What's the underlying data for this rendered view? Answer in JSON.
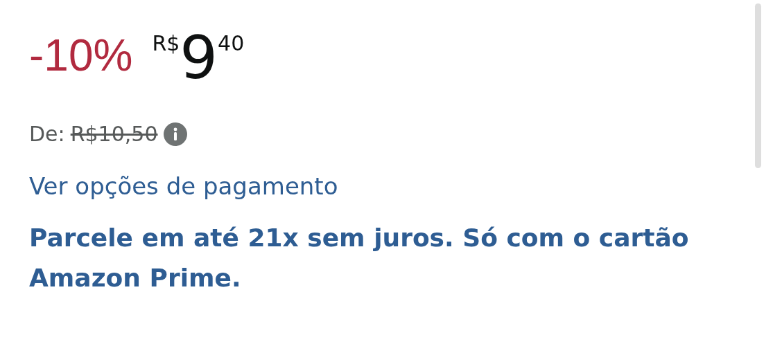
{
  "discount": "-10%",
  "price": {
    "currency": "R$",
    "whole": "9",
    "fraction": "40"
  },
  "list_price": {
    "label": "De:",
    "value": "R$10,50"
  },
  "payment_link": "Ver opções de pagamento",
  "installments": "Parcele em até 21x sem juros. Só com o cartão Amazon Prime."
}
